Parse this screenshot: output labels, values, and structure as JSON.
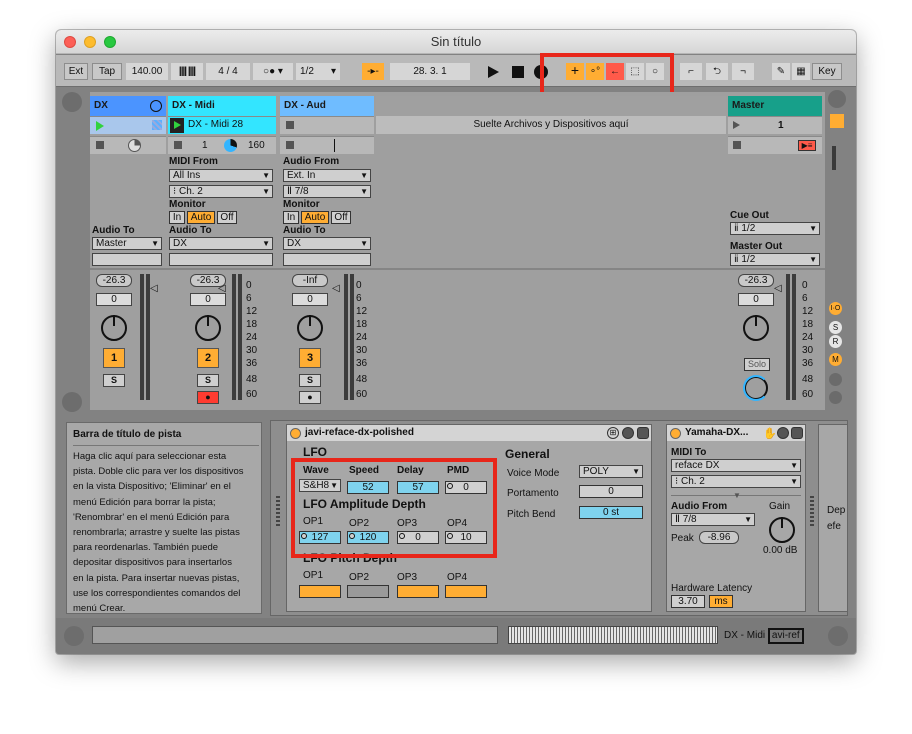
{
  "window": {
    "title": "Sin título"
  },
  "toolbar": {
    "ext": "Ext",
    "tap": "Tap",
    "tempo": "140.00",
    "sig": "4 / 4",
    "quant": "1/2",
    "arrangement_pos": "28.  3.  1",
    "key": "Key"
  },
  "tracks": [
    {
      "name": "DX",
      "color": "#4b94ff",
      "clip": "",
      "audio_to_label": "Audio To",
      "audio_to": "Master",
      "vol": "-26.3",
      "pan": "0",
      "num": "1",
      "solo": "S"
    },
    {
      "name": "DX - Midi",
      "color": "#33e5ff",
      "clip": "DX - Midi 28",
      "clip_pos": "1",
      "clip_val": "160",
      "midi_from_label": "MIDI From",
      "midi_from": "All Ins",
      "midi_ch": "Ch. 2",
      "monitor_label": "Monitor",
      "mon_in": "In",
      "mon_auto": "Auto",
      "mon_off": "Off",
      "audio_to_label": "Audio To",
      "audio_to": "DX",
      "vol": "-26.3",
      "pan": "0",
      "num": "2",
      "solo": "S"
    },
    {
      "name": "DX - Aud",
      "color": "#6fbcff",
      "clip": "",
      "audio_from_label": "Audio From",
      "audio_from": "Ext. In",
      "audio_ch": "7/8",
      "monitor_label": "Monitor",
      "mon_in": "In",
      "mon_auto": "Auto",
      "mon_off": "Off",
      "audio_to_label": "Audio To",
      "audio_to": "DX",
      "vol": "-Inf",
      "pan": "0",
      "num": "3",
      "solo": "S"
    }
  ],
  "drop_hint": "Suelte Archivos y Dispositivos aquí",
  "master": {
    "name": "Master",
    "color": "#17a08a",
    "scene": "1",
    "cue_out_label": "Cue Out",
    "cue_out": "1/2",
    "master_out_label": "Master Out",
    "master_out": "1/2",
    "vol": "-26.3",
    "pan": "0",
    "solo": "Solo"
  },
  "meter_ticks": [
    "0",
    "6",
    "12",
    "18",
    "24",
    "30",
    "36",
    "48",
    "60"
  ],
  "side_buttons": [
    "I·O",
    "S",
    "R",
    "M"
  ],
  "info": {
    "title": "Barra de título de pista",
    "lines": [
      "Haga clic aquí para seleccionar esta",
      "pista. Doble clic para ver los dispositivos",
      "en la vista Dispositivo; 'Eliminar' en el",
      "menú Edición para borrar la pista;",
      "'Renombrar' en el menú Edición para",
      "renombrarla; arrastre y suelte las pistas",
      "para reordenarlas. También puede",
      "depositar dispositivos para insertarlos",
      "en la pista. Para insertar nuevas pistas,",
      "use los correspondientes comandos del",
      "menú Crear."
    ]
  },
  "device1": {
    "title": "javi-reface-dx-polished",
    "lfo_label": "LFO",
    "wave_label": "Wave",
    "wave": "S&H8",
    "speed_label": "Speed",
    "speed": "52",
    "delay_label": "Delay",
    "delay": "57",
    "pmd_label": "PMD",
    "pmd": "0",
    "amp_depth_label": "LFO Amplitude Depth",
    "op_labels": [
      "OP1",
      "OP2",
      "OP3",
      "OP4"
    ],
    "amp_values": [
      "127",
      "120",
      "0",
      "10"
    ],
    "pitch_depth_label": "LFO Pitch Depth",
    "general_label": "General",
    "voice_mode_label": "Voice Mode",
    "voice_mode": "POLY",
    "portamento_label": "Portamento",
    "portamento": "0",
    "pitch_bend_label": "Pitch Bend",
    "pitch_bend": "0 st"
  },
  "device2": {
    "title": "Yamaha-DX...",
    "midi_to_label": "MIDI To",
    "midi_to": "reface DX",
    "midi_ch": "Ch. 2",
    "audio_from_label": "Audio From",
    "audio_from": "7/8",
    "gain_label": "Gain",
    "peak_label": "Peak",
    "peak": "-8.96",
    "gain": "0.00 dB",
    "latency_label": "Hardware Latency",
    "latency": "3.70",
    "latency_unit": "ms"
  },
  "device3_partial": {
    "line1": "Dep",
    "line2": "efe"
  },
  "statusbar": {
    "track": "DX - Midi",
    "device": "avi-ref"
  },
  "colors": {
    "accent": "#ffad33",
    "highlight_box": "#e8261a",
    "lfo_blue": "#7fd3ee"
  }
}
